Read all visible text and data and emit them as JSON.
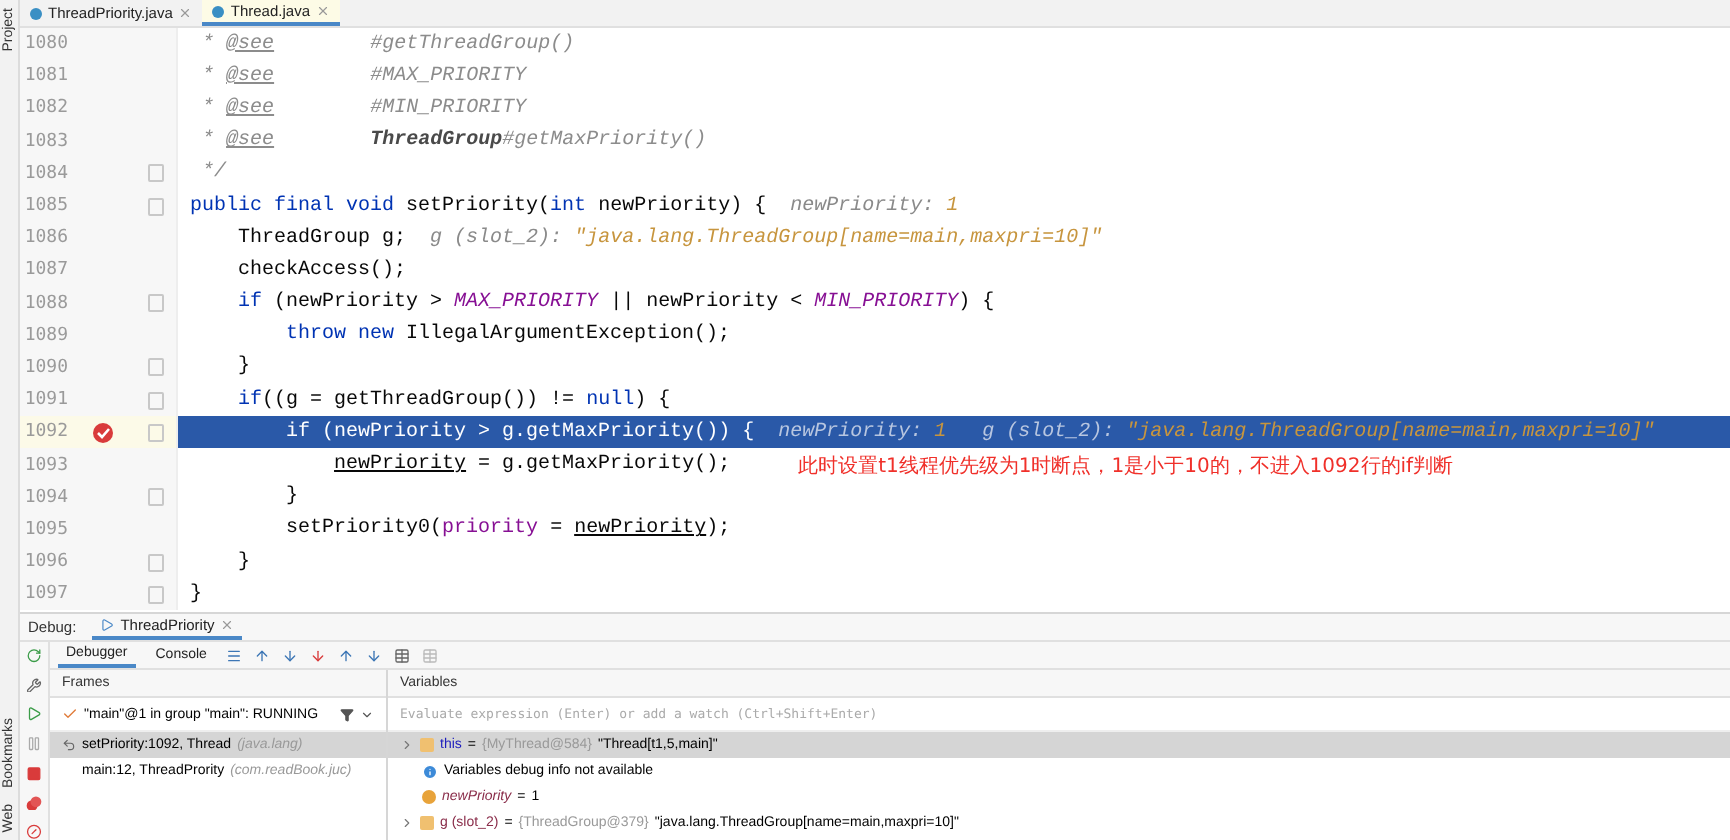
{
  "side_labels": {
    "top": "Project",
    "bottom": [
      "Bookmarks",
      "Web"
    ]
  },
  "editor_tabs": [
    {
      "label": "ThreadPriority.java",
      "selected": false
    },
    {
      "label": "Thread.java",
      "selected": true
    }
  ],
  "code": [
    {
      "number": "1080",
      "fold": false,
      "breakpoint": false,
      "selected": false,
      "tokens": [
        {
          "kind": "doc",
          "text": " * "
        },
        {
          "kind": "doctag",
          "text": "@see"
        },
        {
          "kind": "doc",
          "text": "        #getThreadGroup()"
        }
      ]
    },
    {
      "number": "1081",
      "fold": false,
      "breakpoint": false,
      "selected": false,
      "tokens": [
        {
          "kind": "doc",
          "text": " * "
        },
        {
          "kind": "doctag",
          "text": "@see"
        },
        {
          "kind": "doc",
          "text": "        #MAX_PRIORITY"
        }
      ]
    },
    {
      "number": "1082",
      "fold": false,
      "breakpoint": false,
      "selected": false,
      "tokens": [
        {
          "kind": "doc",
          "text": " * "
        },
        {
          "kind": "doctag",
          "text": "@see"
        },
        {
          "kind": "doc",
          "text": "        #MIN_PRIORITY"
        }
      ]
    },
    {
      "number": "1083",
      "fold": false,
      "breakpoint": false,
      "selected": false,
      "tokens": [
        {
          "kind": "doc",
          "text": " * "
        },
        {
          "kind": "doctag",
          "text": "@see"
        },
        {
          "kind": "docref",
          "text": "        ThreadGroup"
        },
        {
          "kind": "doc",
          "text": "#getMaxPriority()"
        }
      ]
    },
    {
      "number": "1084",
      "fold": true,
      "breakpoint": false,
      "selected": false,
      "tokens": [
        {
          "kind": "doc",
          "text": " */"
        }
      ]
    },
    {
      "number": "1085",
      "fold": true,
      "breakpoint": false,
      "selected": false,
      "tokens": [
        {
          "kind": "kw",
          "text": "public final void "
        },
        {
          "kind": "plain",
          "text": "setPriority("
        },
        {
          "kind": "kw",
          "text": "int "
        },
        {
          "kind": "plain",
          "text": "newPriority) {"
        },
        {
          "kind": "hint",
          "text": "  newPriority: "
        },
        {
          "kind": "hintnum",
          "text": "1"
        }
      ]
    },
    {
      "number": "1086",
      "fold": false,
      "breakpoint": false,
      "selected": false,
      "tokens": [
        {
          "kind": "plain",
          "text": "    ThreadGroup g;"
        },
        {
          "kind": "hint",
          "text": "  g (slot_2): "
        },
        {
          "kind": "hintstr",
          "text": "\"java.lang.ThreadGroup[name=main,maxpri=10]\""
        }
      ]
    },
    {
      "number": "1087",
      "fold": false,
      "breakpoint": false,
      "selected": false,
      "tokens": [
        {
          "kind": "plain",
          "text": "    checkAccess();"
        }
      ]
    },
    {
      "number": "1088",
      "fold": true,
      "breakpoint": false,
      "selected": false,
      "tokens": [
        {
          "kind": "kw",
          "text": "    if "
        },
        {
          "kind": "plain",
          "text": "(newPriority > "
        },
        {
          "kind": "const",
          "text": "MAX_PRIORITY"
        },
        {
          "kind": "plain",
          "text": " || newPriority < "
        },
        {
          "kind": "const",
          "text": "MIN_PRIORITY"
        },
        {
          "kind": "plain",
          "text": ") {"
        }
      ]
    },
    {
      "number": "1089",
      "fold": false,
      "breakpoint": false,
      "selected": false,
      "tokens": [
        {
          "kind": "kw",
          "text": "        throw new "
        },
        {
          "kind": "plain",
          "text": "IllegalArgumentException();"
        }
      ]
    },
    {
      "number": "1090",
      "fold": true,
      "breakpoint": false,
      "selected": false,
      "tokens": [
        {
          "kind": "plain",
          "text": "    }"
        }
      ]
    },
    {
      "number": "1091",
      "fold": true,
      "breakpoint": false,
      "selected": false,
      "tokens": [
        {
          "kind": "kw",
          "text": "    if"
        },
        {
          "kind": "plain",
          "text": "((g = getThreadGroup()) != "
        },
        {
          "kind": "kw",
          "text": "null"
        },
        {
          "kind": "plain",
          "text": ") {"
        }
      ]
    },
    {
      "number": "1092",
      "fold": true,
      "breakpoint": true,
      "selected": true,
      "tokens": [
        {
          "kind": "kw",
          "text": "        if "
        },
        {
          "kind": "plain",
          "text": "(newPriority > g.getMaxPriority()) {"
        },
        {
          "kind": "hint",
          "text": "  newPriority: "
        },
        {
          "kind": "hintnum",
          "text": "1"
        },
        {
          "kind": "hint",
          "text": "   g (slot_2): "
        },
        {
          "kind": "hintstr",
          "text": "\"java.lang.ThreadGroup[name=main,maxpri=10]\""
        }
      ]
    },
    {
      "number": "1093",
      "fold": false,
      "breakpoint": false,
      "selected": false,
      "tokens": [
        {
          "kind": "ref",
          "text": "            newPriority"
        },
        {
          "kind": "plain",
          "text": " = g.getMaxPriority();"
        },
        {
          "kind": "note",
          "text": "此时设置t1线程优先级为1时断点，1是小于10的，不进入1092行的if判断"
        }
      ]
    },
    {
      "number": "1094",
      "fold": true,
      "breakpoint": false,
      "selected": false,
      "tokens": [
        {
          "kind": "plain",
          "text": "        }"
        }
      ]
    },
    {
      "number": "1095",
      "fold": false,
      "breakpoint": false,
      "selected": false,
      "tokens": [
        {
          "kind": "plain",
          "text": "        setPriority0("
        },
        {
          "kind": "field",
          "text": "priority"
        },
        {
          "kind": "plain",
          "text": " = "
        },
        {
          "kind": "ref",
          "text": "newPriority"
        },
        {
          "kind": "plain",
          "text": ");"
        }
      ]
    },
    {
      "number": "1096",
      "fold": true,
      "breakpoint": false,
      "selected": false,
      "tokens": [
        {
          "kind": "plain",
          "text": "    }"
        }
      ]
    },
    {
      "number": "1097",
      "fold": true,
      "breakpoint": false,
      "selected": false,
      "tokens": [
        {
          "kind": "plain",
          "text": "}"
        }
      ]
    }
  ],
  "debug": {
    "label": "Debug:",
    "session_tab": "ThreadPriority",
    "tabs": [
      {
        "label": "Debugger",
        "selected": true
      },
      {
        "label": "Console",
        "selected": false
      }
    ],
    "frames": {
      "header": "Frames",
      "thread": "\"main\"@1 in group \"main\": RUNNING",
      "items": [
        {
          "method": "setPriority:1092, Thread",
          "package": "(java.lang)",
          "selected": true
        },
        {
          "method": "main:12, ThreadPrority",
          "package": "(com.readBook.juc)",
          "selected": false
        }
      ]
    },
    "variables": {
      "header": "Variables",
      "placeholder": "Evaluate expression (Enter) or add a watch (Ctrl+Shift+Enter)",
      "items": [
        {
          "kind": "object",
          "name": "this",
          "eq": "=",
          "type": "{MyThread@584}",
          "value": "\"Thread[t1,5,main]\"",
          "selected": true
        },
        {
          "kind": "info",
          "text": "Variables debug info not available",
          "selected": false
        },
        {
          "kind": "primitive",
          "name": "newPriority",
          "eq": "=",
          "value": "1",
          "selected": false
        },
        {
          "kind": "object",
          "name": "g (slot_2)",
          "eq": "=",
          "type": "{ThreadGroup@379}",
          "value": "\"java.lang.ThreadGroup[name=main,maxpri=10]\"",
          "selected": false
        }
      ]
    }
  }
}
